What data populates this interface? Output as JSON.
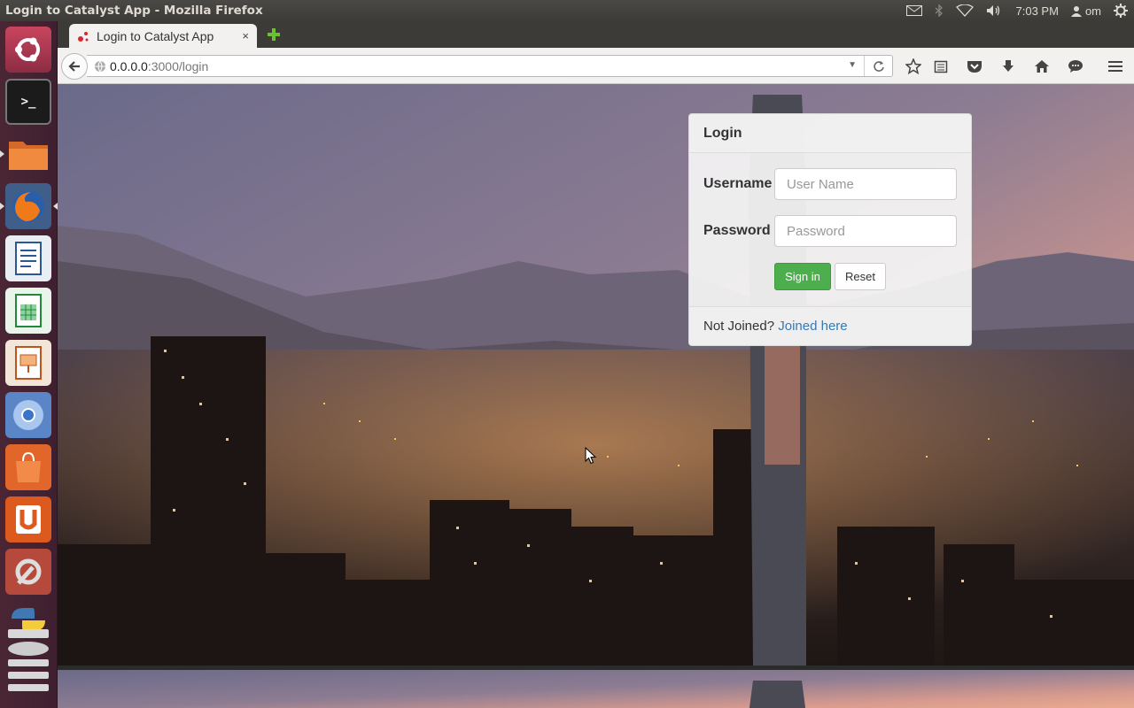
{
  "window": {
    "title": "Login to Catalyst App - Mozilla Firefox"
  },
  "panel": {
    "clock": "7:03 PM",
    "user": "om"
  },
  "launcher": {
    "items": [
      {
        "name": "ubuntu-dash-icon"
      },
      {
        "name": "terminal-icon"
      },
      {
        "name": "files-icon"
      },
      {
        "name": "firefox-icon"
      },
      {
        "name": "writer-icon"
      },
      {
        "name": "calc-icon"
      },
      {
        "name": "impress-icon"
      },
      {
        "name": "chromium-icon"
      },
      {
        "name": "software-center-icon"
      },
      {
        "name": "ubuntu-one-icon"
      },
      {
        "name": "system-settings-icon"
      },
      {
        "name": "python-icon"
      },
      {
        "name": "disks-icon"
      }
    ]
  },
  "browser": {
    "tab_title": "Login to Catalyst App",
    "tab_close": "×",
    "url_host": "0.0.0.0",
    "url_path": ":3000/login"
  },
  "login": {
    "heading": "Login",
    "username_label": "Username",
    "username_placeholder": "User Name",
    "password_label": "Password",
    "password_placeholder": "Password",
    "signin_label": "Sign in",
    "reset_label": "Reset",
    "footer_text": "Not Joined? ",
    "footer_link": "Joined here"
  },
  "colors": {
    "signin": "#4cae4c",
    "link": "#337ab7",
    "launcher": "#4a2634"
  }
}
